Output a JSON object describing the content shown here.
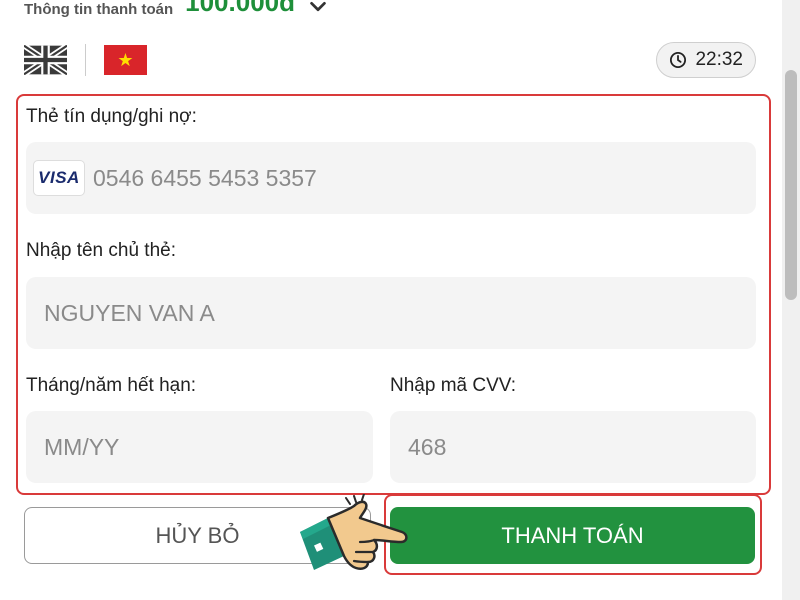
{
  "payment_summary": {
    "label": "Thông tin thanh toán",
    "amount": "100.000đ",
    "chevron_icon": "chevron-down-icon"
  },
  "languages": {
    "english_flag_icon": "uk-flag-icon",
    "vietnamese_flag_icon": "vietnam-flag-icon"
  },
  "timer": {
    "icon": "clock-icon",
    "value": "22:32"
  },
  "card_form": {
    "card_number": {
      "label": "Thẻ tín dụng/ghi nợ:",
      "brand": "VISA",
      "value": "0546 6455 5453 5357"
    },
    "cardholder_name": {
      "label": "Nhập tên chủ thẻ:",
      "value": "NGUYEN VAN A"
    },
    "expiry": {
      "label": "Tháng/năm hết hạn:",
      "placeholder": "MM/YY"
    },
    "cvv": {
      "label": "Nhập mã CVV:",
      "value": "468"
    }
  },
  "actions": {
    "cancel_label": "HỦY BỎ",
    "pay_label": "THANH TOÁN"
  },
  "colors": {
    "accent_green": "#22923f",
    "highlight_red": "#d93a3a",
    "amount_green": "#1e8f3a"
  }
}
